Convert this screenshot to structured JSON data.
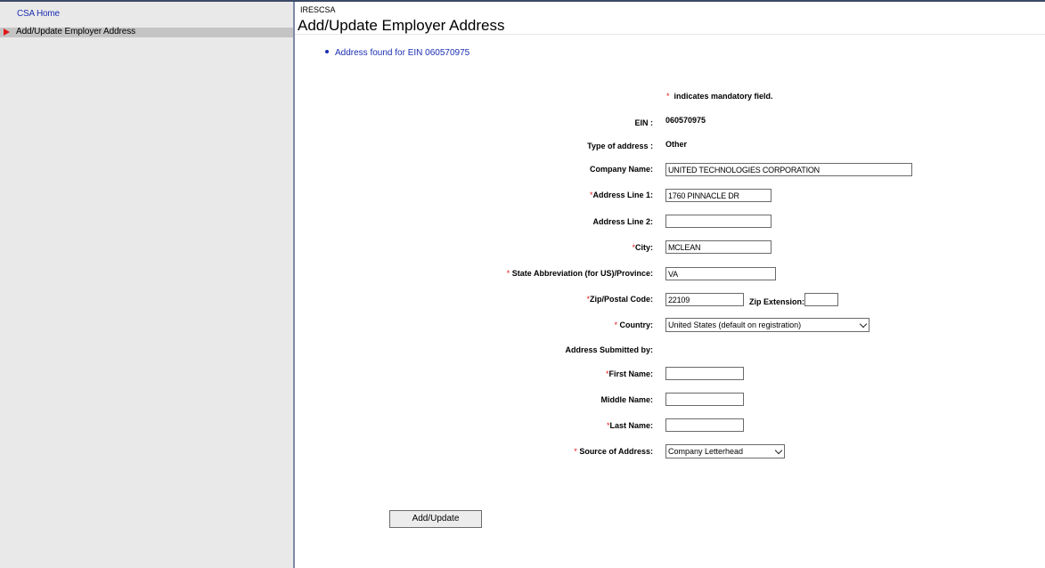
{
  "sidebar": {
    "home_link": "CSA Home",
    "active_item": "Add/Update Employer Address"
  },
  "header": {
    "app_id": "IRESCSA",
    "page_title": "Add/Update Employer Address"
  },
  "message": "Address found for EIN 060570975",
  "mandatory_note": "indicates mandatory field.",
  "required_marker": "*",
  "form": {
    "ein_label": "EIN :",
    "ein_value": "060570975",
    "type_label": "Type of address :",
    "type_value": "Other",
    "company_label": "Company Name:",
    "company_value": "UNITED TECHNOLOGIES CORPORATION",
    "addr1_label": "Address Line 1:",
    "addr1_value": "1760 PINNACLE DR",
    "addr2_label": "Address Line 2:",
    "addr2_value": "",
    "city_label": "City:",
    "city_value": "MCLEAN",
    "state_label": "State Abbreviation (for US)/Province:",
    "state_value": "VA",
    "zip_label": "Zip/Postal Code:",
    "zip_value": "22109",
    "zipext_label": "Zip Extension:",
    "zipext_value": "",
    "country_label": "Country:",
    "country_value": "United States (default on registration)",
    "submitted_label": "Address Submitted by:",
    "first_label": "First Name:",
    "first_value": "",
    "middle_label": "Middle Name:",
    "middle_value": "",
    "last_label": "Last Name:",
    "last_value": "",
    "source_label": "Source of Address:",
    "source_value": "Company Letterhead"
  },
  "submit_label": "Add/Update",
  "colors": {
    "link": "#1c2fb3",
    "required": "#e0161b",
    "sidebar_bg": "#e9e9e9",
    "sidebar_active_bg": "#c4c4c4"
  }
}
